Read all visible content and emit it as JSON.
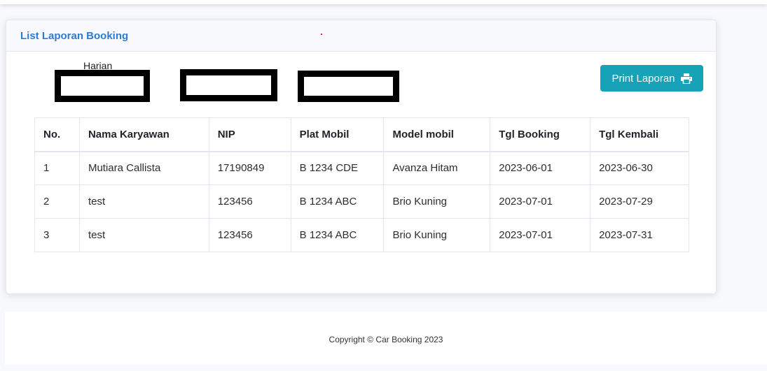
{
  "card": {
    "title": "List Laporan Booking"
  },
  "filter": {
    "label": "Harian"
  },
  "actions": {
    "print_label": "Print Laporan",
    "print_icon": "printer-icon"
  },
  "table": {
    "headers": [
      "No.",
      "Nama Karyawan",
      "NIP",
      "Plat Mobil",
      "Model mobil",
      "Tgl Booking",
      "Tgl Kembali"
    ],
    "rows": [
      [
        "1",
        "Mutiara Callista",
        "17190849",
        "B 1234 CDE",
        "Avanza Hitam",
        "2023-06-01",
        "2023-06-30"
      ],
      [
        "2",
        "test",
        "123456",
        "B 1234 ABC",
        "Brio Kuning",
        "2023-07-01",
        "2023-07-29"
      ],
      [
        "3",
        "test",
        "123456",
        "B 1234 ABC",
        "Brio Kuning",
        "2023-07-01",
        "2023-07-31"
      ]
    ]
  },
  "footer": {
    "copyright": "Copyright © Car Booking 2023"
  },
  "colors": {
    "accent": "#2e7bd6",
    "button": "#17a2b8"
  }
}
